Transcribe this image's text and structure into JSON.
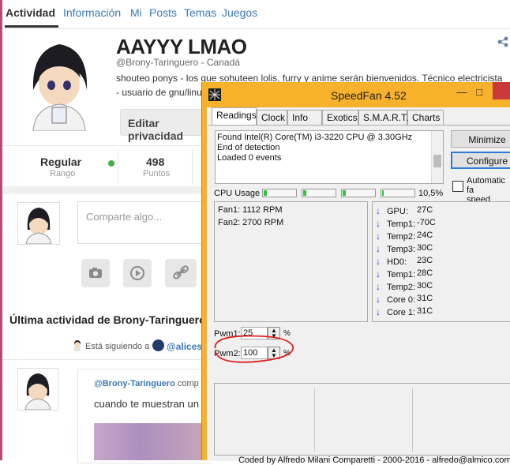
{
  "page": {
    "nav_tabs": [
      "Actividad",
      "Información",
      "Mi",
      "Posts",
      "Temas",
      "Juegos"
    ],
    "profile": {
      "name": "AAYYY LMAO",
      "handle": "@Brony-Taringuero - Canadá",
      "bio_line1": "shouteo ponys - los que sohuteen lolis, furry y anime serán bienvenidos. Técnico electricista",
      "bio_line2": "- usuario de gnu/linux"
    },
    "edit_button": "Editar privacidad",
    "stats": {
      "rank_value": "Regular",
      "rank_label": "Rango",
      "points_value": "498",
      "points_label": "Puntos"
    },
    "composer_placeholder": "Comparte algo...",
    "section_title": "Última actividad de Brony-Taringuero",
    "following_text": "Está siguiendo a",
    "following_user": "@alicesi",
    "post_author": "@Brony-Taringuero",
    "post_meta_rest": "comp",
    "post_text": "cuando te muestran un"
  },
  "speedfan": {
    "title": "SpeedFan 4.52",
    "tabs": [
      "Readings",
      "Clock",
      "Info",
      "Exotics",
      "S.M.A.R.T.",
      "Charts"
    ],
    "log_lines": [
      "Found Intel(R) Core(TM) i3-3220 CPU @ 3.30GHz",
      "End of detection",
      "Loaded 0 events"
    ],
    "buttons": {
      "minimize": "Minimize",
      "configure": "Configure"
    },
    "auto_fan_label_1": "Automatic fa",
    "auto_fan_label_2": "speed",
    "cpu_usage_label": "CPU Usage",
    "cpu_usage_value": "10,5%",
    "fans": [
      "Fan1: 1112 RPM",
      "Fan2: 2700 RPM"
    ],
    "temps": [
      {
        "name": "GPU:",
        "value": "27C"
      },
      {
        "name": "Temp1:",
        "value": "-70C"
      },
      {
        "name": "Temp2:",
        "value": "24C"
      },
      {
        "name": "Temp3:",
        "value": "30C"
      },
      {
        "name": "HD0:",
        "value": "23C"
      },
      {
        "name": "Temp1:",
        "value": "28C"
      },
      {
        "name": "Temp2:",
        "value": "30C"
      },
      {
        "name": "Core 0:",
        "value": "31C"
      },
      {
        "name": "Core 1:",
        "value": "31C"
      }
    ],
    "pwm1": {
      "label": "Pwm1:",
      "value": "25",
      "unit": "%"
    },
    "pwm2": {
      "label": "Pwm2:",
      "value": "100",
      "unit": "%"
    },
    "footer": "Coded by Alfredo Milani Comparetti - 2000-2016 - alfredo@almico.com",
    "colors": {
      "window": "#f7b12a",
      "close": "#c9383a",
      "arrow": "#1e3cd1",
      "annotation": "#e0201f"
    }
  }
}
